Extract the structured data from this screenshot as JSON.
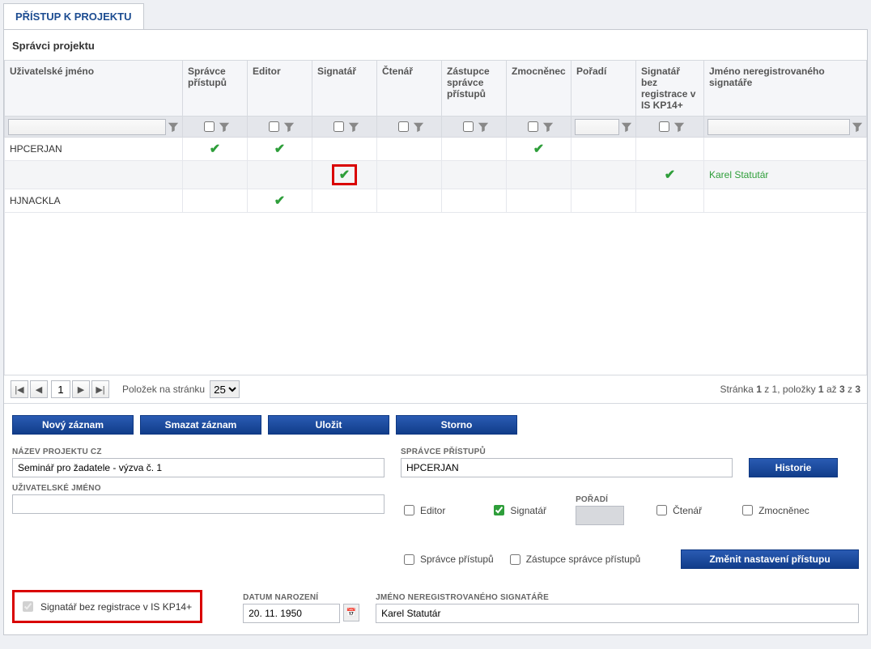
{
  "tab_title": "PŘÍSTUP K PROJEKTU",
  "section_title": "Správci projektu",
  "columns": {
    "username": "Uživatelské jméno",
    "admin": "Správce přístupů",
    "editor": "Editor",
    "signer": "Signatář",
    "reader": "Čtenář",
    "deputy": "Zástupce správce přístupů",
    "delegate": "Zmocněnec",
    "order": "Pořadí",
    "signer_no_reg": "Signatář bez registrace v IS KP14+",
    "unreg_name": "Jméno neregistrovaného signatáře"
  },
  "rows": [
    {
      "username": "HPCERJAN",
      "admin": true,
      "editor": true,
      "signer": false,
      "reader": false,
      "deputy": false,
      "delegate": true,
      "order": "",
      "signer_no_reg": false,
      "unreg_name": ""
    },
    {
      "username": "",
      "admin": false,
      "editor": false,
      "signer": true,
      "reader": false,
      "deputy": false,
      "delegate": false,
      "order": "",
      "signer_no_reg": true,
      "unreg_name": "Karel Statutár"
    },
    {
      "username": "HJNACKLA",
      "admin": false,
      "editor": true,
      "signer": false,
      "reader": false,
      "deputy": false,
      "delegate": false,
      "order": "",
      "signer_no_reg": false,
      "unreg_name": ""
    }
  ],
  "pager": {
    "page": "1",
    "items_label": "Položek na stránku",
    "page_size": "25",
    "summary_prefix": "Stránka ",
    "summary_page_bold": "1",
    "summary_mid1": " z 1, položky ",
    "summary_item_bold": "1",
    "summary_mid2": " až ",
    "summary_total_bold1": "3",
    "summary_mid3": " z ",
    "summary_total_bold2": "3"
  },
  "buttons": {
    "new": "Nový záznam",
    "delete": "Smazat záznam",
    "save": "Uložit",
    "cancel": "Storno",
    "history": "Historie",
    "change": "Změnit nastavení přístupu"
  },
  "form": {
    "project_label": "NÁZEV PROJEKTU CZ",
    "project_value": "Seminář pro žadatele - výzva č. 1",
    "admin_label": "SPRÁVCE PŘÍSTUPŮ",
    "admin_value": "HPCERJAN",
    "username_label": "UŽIVATELSKÉ JMÉNO",
    "username_value": "",
    "editor_chk": "Editor",
    "signer_chk": "Signatář",
    "order_label": "POŘADÍ",
    "reader_chk": "Čtenář",
    "delegate_chk": "Zmocněnec",
    "admin_chk": "Správce přístupů",
    "deputy_chk": "Zástupce správce přístupů",
    "signer_noreg_chk": "Signatář bez registrace v IS KP14+",
    "dob_label": "DATUM NAROZENÍ",
    "dob_value": "20. 11. 1950",
    "unreg_name_label": "JMÉNO NEREGISTROVANÉHO SIGNATÁŘE",
    "unreg_name_value": "Karel Statutár"
  }
}
